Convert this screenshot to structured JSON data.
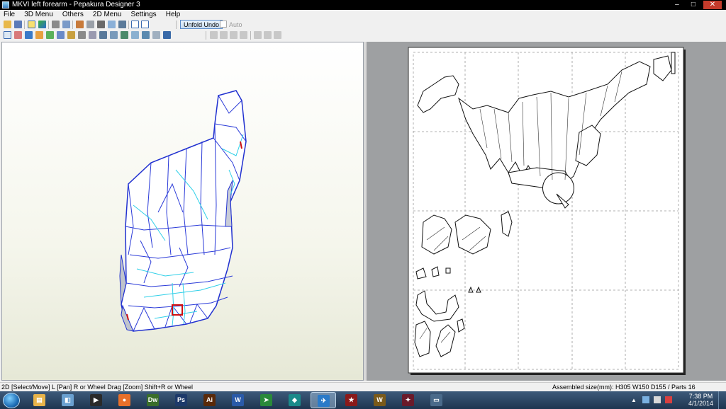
{
  "window": {
    "title": "MKVI left forearm - Pepakura Designer 3",
    "controls": [
      "–",
      "□",
      "✕"
    ]
  },
  "menu": [
    "File",
    "3D Menu",
    "Others",
    "2D Menu",
    "Settings",
    "Help"
  ],
  "toolbar": {
    "unfold_undo_label": "Unfold Undo",
    "auto_label": "Auto",
    "auto_checked": false
  },
  "status": {
    "left": "2D [Select/Move] L [Pan] R or Wheel Drag [Zoom] Shift+R or Wheel",
    "right": "Assembled size(mm): H305 W150 D155 / Parts 16"
  },
  "taskbar": {
    "apps": [
      {
        "name": "file-explorer",
        "color": "#e8b44a",
        "glyph": "▤",
        "active": false
      },
      {
        "name": "app-blue-glass",
        "color": "#6aa0d0",
        "glyph": "◧",
        "active": false
      },
      {
        "name": "media-player",
        "color": "#2a2a2a",
        "glyph": "▶",
        "active": false
      },
      {
        "name": "firefox",
        "color": "#e8702a",
        "glyph": "●",
        "active": false
      },
      {
        "name": "dreamweaver",
        "color": "#3a6e2a",
        "glyph": "Dw",
        "active": false
      },
      {
        "name": "photoshop",
        "color": "#1d3a6a",
        "glyph": "Ps",
        "active": false
      },
      {
        "name": "illustrator",
        "color": "#5a2a0a",
        "glyph": "Ai",
        "active": false
      },
      {
        "name": "word",
        "color": "#2a5aa8",
        "glyph": "W",
        "active": false
      },
      {
        "name": "app-green-arrow",
        "color": "#2a8a3a",
        "glyph": "➤",
        "active": false
      },
      {
        "name": "app-teal",
        "color": "#1a8a8a",
        "glyph": "◆",
        "active": false
      },
      {
        "name": "pepakura",
        "color": "#2a7ac8",
        "glyph": "✈",
        "active": true
      },
      {
        "name": "app-red-star",
        "color": "#8a1a1a",
        "glyph": "★",
        "active": false
      },
      {
        "name": "world-of-warcraft",
        "color": "#7a5a1a",
        "glyph": "W",
        "active": false
      },
      {
        "name": "app-red-shape",
        "color": "#6a1a2a",
        "glyph": "✦",
        "active": false
      },
      {
        "name": "app-window",
        "color": "#4a6a8a",
        "glyph": "▭",
        "active": false
      }
    ],
    "clock": {
      "time": "7:38 PM",
      "date": "4/1/2014"
    }
  }
}
